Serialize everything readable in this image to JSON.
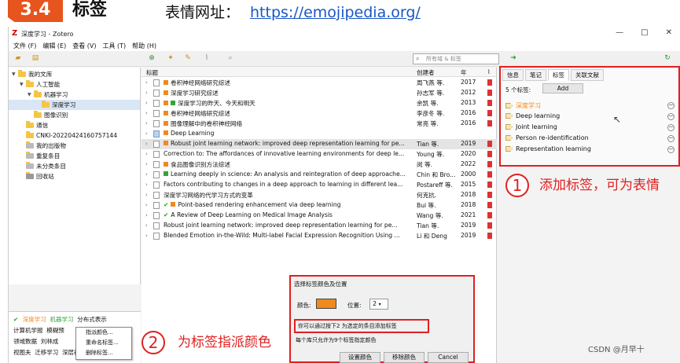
{
  "header": {
    "badge": "3.4",
    "title": "标签",
    "emoji_label": "表情网址：",
    "emoji_link": "https://emojipedia.org/"
  },
  "window": {
    "title": "深度学习 - Zotero",
    "controls": [
      "—",
      "□",
      "✕"
    ]
  },
  "menu": [
    "文件 (F)",
    "编辑 (E)",
    "查看 (V)",
    "工具 (T)",
    "帮助 (H)"
  ],
  "toolbar": {
    "search_placeholder": "所有域 & 标签"
  },
  "tree": [
    {
      "label": "我的文库",
      "level": 0
    },
    {
      "label": "人工智能",
      "level": 1
    },
    {
      "label": "机器学习",
      "level": 2
    },
    {
      "label": "深度学习",
      "level": 3,
      "selected": true
    },
    {
      "label": "图像识别",
      "level": 2
    },
    {
      "label": "通信",
      "level": 1
    },
    {
      "label": "CNKI-20220424160757144",
      "level": 1
    },
    {
      "label": "我的出版物",
      "level": 1
    },
    {
      "label": "重复条目",
      "level": 1
    },
    {
      "label": "未分类条目",
      "level": 1
    },
    {
      "label": "回收站",
      "level": 1
    }
  ],
  "tag_pane": {
    "row1": [
      "深度学习",
      "机器学习",
      "分布式表示"
    ],
    "row2": [
      "计算机学报",
      "模糊预"
    ],
    "row3": [
      "领域数据",
      "刘林成"
    ],
    "row4": [
      "视图夫",
      "迁移学习",
      "深层神"
    ]
  },
  "context_menu": [
    "指派颜色...",
    "重命名标签...",
    "删除标签..."
  ],
  "columns": {
    "title": "标题",
    "creator": "创建者",
    "year": "年"
  },
  "items": [
    {
      "title": "卷积神经网络研究综述",
      "creator": "周飞燕 等.",
      "year": "2017",
      "marks": "o"
    },
    {
      "title": "深度学习研究综述",
      "creator": "孙志军 等.",
      "year": "2012",
      "marks": "o"
    },
    {
      "title": "深度学习的昨天、今天和明天",
      "creator": "余凯 等.",
      "year": "2013",
      "marks": "og"
    },
    {
      "title": "卷积神经网络研究综述",
      "creator": "李彦冬 等.",
      "year": "2016",
      "marks": "o"
    },
    {
      "title": "图像理解中的卷积神经网络",
      "creator": "常亮 等.",
      "year": "2016",
      "marks": "o"
    },
    {
      "title": "Deep Learning",
      "creator": "",
      "year": "",
      "marks": "folder"
    },
    {
      "title": "Robust joint learning network: improved deep representation learning for pe...",
      "creator": "Tian 等.",
      "year": "2019",
      "marks": "o",
      "selected": true
    },
    {
      "title": "Correction to: The affordances of innovative learning environments for deep le...",
      "creator": "Young 等.",
      "year": "2020",
      "marks": ""
    },
    {
      "title": "食品图像识别方法综述",
      "creator": "闵 等.",
      "year": "2022",
      "marks": "o"
    },
    {
      "title": "Learning deeply in science: An analysis and reintegration of deep approache...",
      "creator": "Chin 和 Bro...",
      "year": "2000",
      "marks": "g"
    },
    {
      "title": "Factors contributing to changes in a deep approach to learning in different lea...",
      "creator": "Postareff 等.",
      "year": "2015",
      "marks": ""
    },
    {
      "title": "深度学习网络的代学习方式的变革",
      "creator": "何克抗.",
      "year": "2018",
      "marks": ""
    },
    {
      "title": "Point-based rendering enhancement via deep learning",
      "creator": "Bui 等.",
      "year": "2018",
      "marks": "co"
    },
    {
      "title": "A Review of Deep Learning on Medical Image Analysis",
      "creator": "Wang 等.",
      "year": "2021",
      "marks": "c"
    },
    {
      "title": "Robust joint learning network: improved deep representation learning for pe...",
      "creator": "Tian 等.",
      "year": "2019",
      "marks": ""
    },
    {
      "title": "Blended Emotion in-the-Wild: Multi-label Facial Expression Recognition Using ...",
      "creator": "Li 和 Deng",
      "year": "2019",
      "marks": ""
    }
  ],
  "right": {
    "tabs": [
      "信息",
      "笔记",
      "标签",
      "关联文献"
    ],
    "tag_count": "5 个标签:",
    "add_label": "Add",
    "tags": [
      "深度学习",
      "Deep learning",
      "Joint learning",
      "Person re-identification",
      "Representation learning"
    ]
  },
  "callouts": {
    "one_num": "1",
    "one_text": "添加标签，可为表情",
    "two_num": "2",
    "two_text": "为标签指派颜色"
  },
  "dialog": {
    "title": "选择标签颜色及位置",
    "color_label": "颜色:",
    "position_label": "位置:",
    "position_value": "2",
    "hint": "你可以通过按下2 为选定的条目添加标签",
    "note": "每个库只允许为9个标签指定颜色",
    "buttons": [
      "设置颜色",
      "移除颜色",
      "Cancel"
    ],
    "accent": "#ef8a1e"
  },
  "watermark": "CSDN @月早十"
}
